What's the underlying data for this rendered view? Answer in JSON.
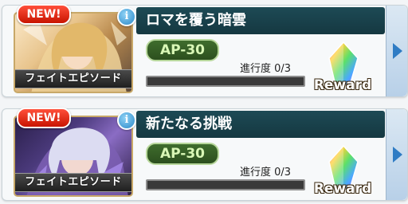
{
  "cards": [
    {
      "new_badge": "NEW!",
      "info_icon": "i",
      "title": "ロマを覆う暗雲",
      "ap": "AP-30",
      "progress_label": "進行度 0/3",
      "progress_fraction": 0,
      "episode_label": "フェイトエピソード",
      "reward_label": "Reward"
    },
    {
      "new_badge": "NEW!",
      "info_icon": "i",
      "title": "新たなる挑戦",
      "ap": "AP-30",
      "progress_label": "進行度 0/3",
      "progress_fraction": 0,
      "episode_label": "フェイトエピソード",
      "reward_label": "Reward"
    }
  ],
  "colors": {
    "title_bar": "#1d4a55",
    "ap_pill": "#3f6d2d",
    "new_badge": "#e6301b",
    "arrow_tab": "#c8daec"
  },
  "icons": {
    "info": "info-icon",
    "reward": "rainbow-crystal-icon",
    "arrow": "chevron-right-icon"
  }
}
